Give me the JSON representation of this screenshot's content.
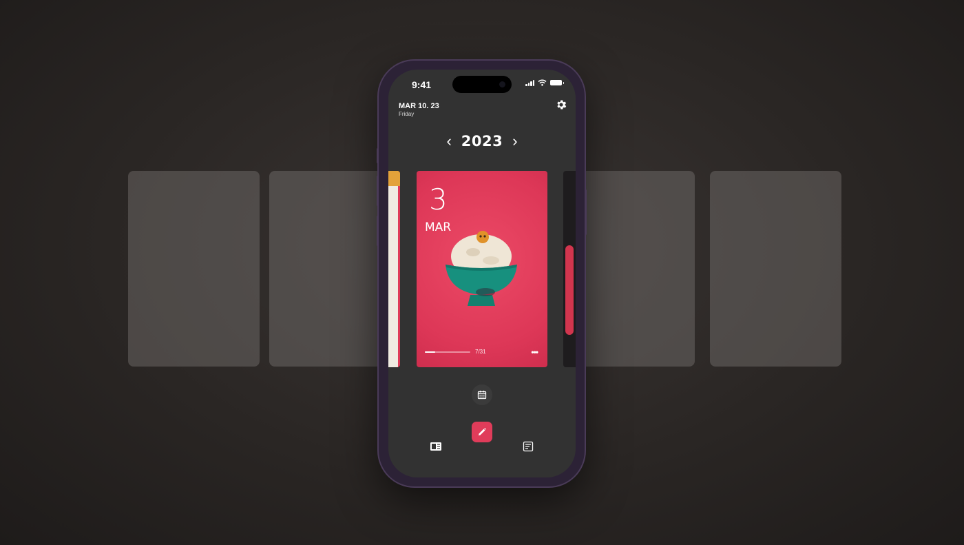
{
  "status_bar": {
    "time": "9:41"
  },
  "header": {
    "date": "MAR 10. 23",
    "weekday": "Friday"
  },
  "year_nav": {
    "prev": "‹",
    "year": "2023",
    "next": "›"
  },
  "card": {
    "day": "3",
    "month": "MAR",
    "progress": 0.23,
    "progress_label": "7/31",
    "more": "•••",
    "bg_color": "#dd3757"
  },
  "icons": {
    "settings": "gear-icon",
    "calendar": "calendar-icon",
    "edit": "pencil-icon",
    "gallery": "gallery-view-icon",
    "list": "list-view-icon"
  },
  "colors": {
    "accent": "#e03c5a",
    "screen_bg": "#323232"
  }
}
